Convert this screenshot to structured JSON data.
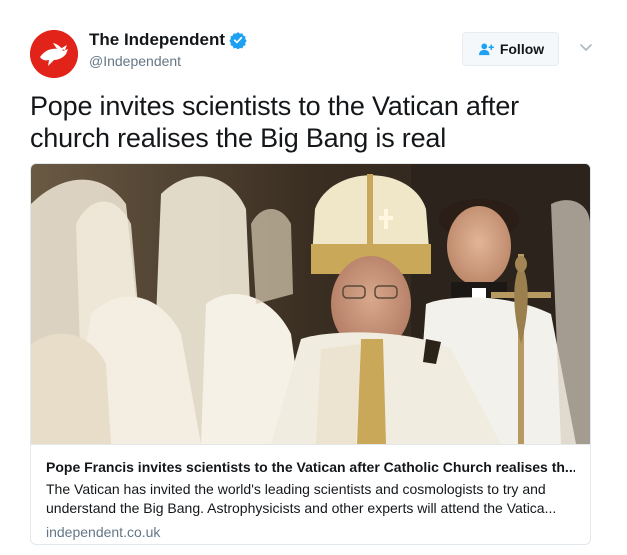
{
  "author": {
    "display_name": "The Independent",
    "handle": "@Independent",
    "verified": true,
    "avatar_icon": "independent-eagle-logo",
    "brand_color": "#e2231a"
  },
  "follow_button": {
    "label": "Follow",
    "icon": "follow-person-plus-icon"
  },
  "menu_caret": {
    "icon": "chevron-down-icon"
  },
  "tweet": {
    "text": "Pope invites scientists to the Vatican after church realises the Big Bang is real"
  },
  "card": {
    "image_alt": "Pope Francis in white and gold vestments holding a crucifix staff",
    "title": "Pope Francis invites scientists to the Vatican after Catholic Church realises th...",
    "description": "The Vatican has invited the world's leading scientists and cosmologists to try and understand the Big Bang. Astrophysicists and other experts will attend the Vatica...",
    "domain": "independent.co.uk"
  }
}
